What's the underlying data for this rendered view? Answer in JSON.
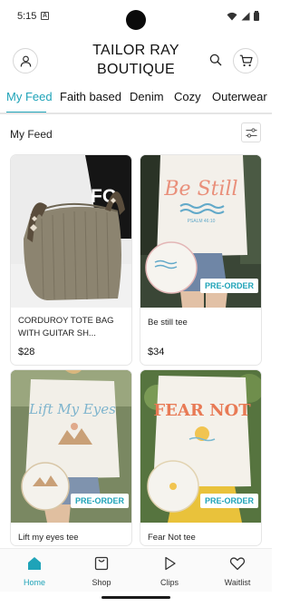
{
  "status_bar": {
    "time": "5:15",
    "notification_glyph": "A"
  },
  "header": {
    "brand": "TAILOR RAY\nBOUTIQUE",
    "icons": [
      "profile-icon",
      "search-icon",
      "cart-icon"
    ]
  },
  "tabs": [
    {
      "label": "My Feed",
      "active": true
    },
    {
      "label": "Faith based",
      "active": false
    },
    {
      "label": "Denim",
      "active": false
    },
    {
      "label": "Cozy",
      "active": false
    },
    {
      "label": "Outerwear",
      "active": false
    }
  ],
  "feed": {
    "title": "My Feed",
    "filter_icon": "sliders-icon"
  },
  "products": [
    {
      "name": "CORDUROY TOTE BAG WITH GUITAR SH...",
      "price": "$28",
      "preorder": "",
      "image": "tote-bag",
      "art_text": "FO"
    },
    {
      "name": "Be still tee",
      "price": "$34",
      "preorder": "PRE-ORDER",
      "image": "be-still-tee",
      "art_text": "Be Still",
      "art_subtext": "PSALM 46:10"
    },
    {
      "name": "Lift my eyes tee",
      "price": "",
      "preorder": "PRE-ORDER",
      "image": "lift-my-eyes-tee",
      "art_text": "Lift My Eyes"
    },
    {
      "name": "Fear Not tee",
      "price": "",
      "preorder": "PRE-ORDER",
      "image": "fear-not-tee",
      "art_text": "FEAR NOT"
    }
  ],
  "bottom_nav": [
    {
      "label": "Home",
      "icon": "home-icon",
      "active": true
    },
    {
      "label": "Shop",
      "icon": "shopping-bag-icon",
      "active": false
    },
    {
      "label": "Clips",
      "icon": "play-icon",
      "active": false
    },
    {
      "label": "Waitlist",
      "icon": "heart-icon",
      "active": false
    }
  ],
  "colors": {
    "accent": "#1fa3b8",
    "text": "#1a1a1a",
    "border": "#e6e6e6"
  }
}
